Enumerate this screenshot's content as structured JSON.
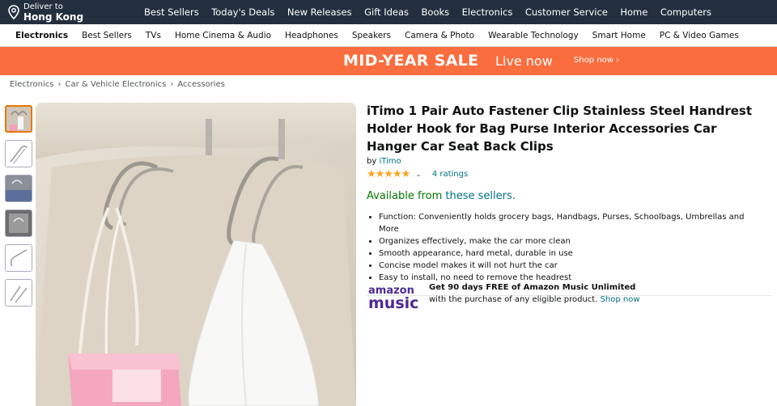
{
  "nav": {
    "deliver_small": "Deliver to",
    "deliver_big": "Hong Kong",
    "links": [
      "Best Sellers",
      "Today's Deals",
      "New Releases",
      "Gift Ideas",
      "Books",
      "Electronics",
      "Customer Service",
      "Home",
      "Computers"
    ]
  },
  "subnav": {
    "items": [
      "Electronics",
      "Best Sellers",
      "TVs",
      "Home Cinema & Audio",
      "Headphones",
      "Speakers",
      "Camera & Photo",
      "Wearable Technology",
      "Smart Home",
      "PC & Video Games"
    ]
  },
  "banner": {
    "title": "MID-YEAR SALE",
    "live": "Live now",
    "shop": "Shop now ›"
  },
  "breadcrumb": [
    "Electronics",
    "Car & Vehicle Electronics",
    "Accessories"
  ],
  "product": {
    "title": "iTimo 1 Pair Auto Fastener Clip Stainless Steel Handrest Holder Hook for Bag Purse Interior Accessories Car Hanger Car Seat Back Clips",
    "by": "by",
    "brand": "iTimo",
    "stars": "★★★★★",
    "ratings": "4 ratings",
    "available_prefix": "Available from",
    "available_link": "these sellers.",
    "bullets": [
      "Function: Conveniently holds grocery bags, Handbags, Purses, Schoolbags, Umbrellas and More",
      "Organizes effectively, make the car more clean",
      "Smooth appearance, hard metal, durable in use",
      "Concise model makes it will not hurt the car",
      "Easy to install, no need to remove the headrest"
    ]
  },
  "promo": {
    "logo_top": "amazon",
    "logo_bottom": "music",
    "headline": "Get 90 days FREE of Amazon Music Unlimited",
    "body": "with the purchase of any eligible product.",
    "link": "Shop now"
  },
  "colors": {
    "nav_bg": "#232f3e",
    "banner_bg": "#fa6d3e",
    "link": "#007185",
    "available": "#007600",
    "star": "#ffa41c",
    "music": "#4b2a96"
  }
}
